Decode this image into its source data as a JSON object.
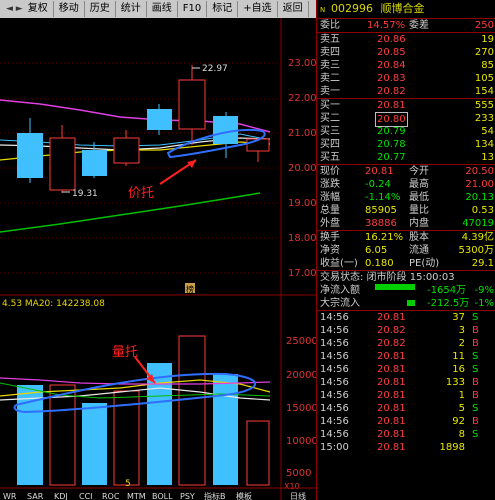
{
  "toolbar": {
    "buttons": [
      "复权",
      "移动",
      "历史",
      "统计",
      "画线",
      "F10",
      "标记",
      "+自选",
      "返回"
    ],
    "close": "×"
  },
  "chart": {
    "price_ticks": [
      "23.00",
      "22.00",
      "21.00",
      "20.00",
      "19.00",
      "18.00",
      "17.00"
    ],
    "high_label": "22.97",
    "low_label": "19.31",
    "annotation_price": "价托",
    "annotation_volume": "量托",
    "marker": "榜",
    "vol_header": "4.53  MA20: 142238.08",
    "vol_ticks": [
      "25000",
      "20000",
      "15000",
      "10000",
      "5000"
    ],
    "vol_unit": "X10",
    "bottom_tabs": [
      "WR",
      "SAR",
      "KDJ",
      "CCI",
      "ROC",
      "MTM",
      "BOLL",
      "PSY",
      "指标B",
      "模板"
    ],
    "bottom_right": "日线",
    "bottom_digit": "5"
  },
  "quote": {
    "code": "002996",
    "name": "顺博合金",
    "wei_bi_label": "委比",
    "wei_bi": "14.57%",
    "wei_cha_label": "委差",
    "wei_cha": "250",
    "asks": [
      {
        "label": "卖五",
        "price": "20.86",
        "vol": "19"
      },
      {
        "label": "卖四",
        "price": "20.85",
        "vol": "270"
      },
      {
        "label": "卖三",
        "price": "20.84",
        "vol": "85"
      },
      {
        "label": "卖二",
        "price": "20.83",
        "vol": "105"
      },
      {
        "label": "卖一",
        "price": "20.82",
        "vol": "154"
      }
    ],
    "bids": [
      {
        "label": "买一",
        "price": "20.81",
        "vol": "555"
      },
      {
        "label": "买二",
        "price": "20.80",
        "vol": "233"
      },
      {
        "label": "买三",
        "price": "20.79",
        "vol": "54"
      },
      {
        "label": "买四",
        "price": "20.78",
        "vol": "134"
      },
      {
        "label": "买五",
        "price": "20.77",
        "vol": "13"
      }
    ],
    "stats": [
      {
        "l1": "现价",
        "v1": "20.81",
        "l2": "今开",
        "v2": "20.50",
        "c1": "red",
        "c2": "red"
      },
      {
        "l1": "涨跌",
        "v1": "-0.24",
        "l2": "最高",
        "v2": "21.00",
        "c1": "green",
        "c2": "red"
      },
      {
        "l1": "涨幅",
        "v1": "-1.14%",
        "l2": "最低",
        "v2": "20.13",
        "c1": "green",
        "c2": "green"
      },
      {
        "l1": "总量",
        "v1": "85905",
        "l2": "量比",
        "v2": "0.53",
        "c1": "yellow",
        "c2": "yellow"
      },
      {
        "l1": "外盘",
        "v1": "38886",
        "l2": "内盘",
        "v2": "47019",
        "c1": "red",
        "c2": "green"
      }
    ],
    "stats2": [
      {
        "l1": "换手",
        "v1": "16.21%",
        "l2": "股本",
        "v2": "4.39亿"
      },
      {
        "l1": "净资",
        "v1": "6.05",
        "l2": "流通",
        "v2": "5300万"
      },
      {
        "l1": "收益(一)",
        "v1": "0.180",
        "l2": "PE(动)",
        "v2": "29.1"
      }
    ],
    "status_label": "交易状态: 闭市阶段 15:00:03",
    "net_inflow_label": "净流入额",
    "net_inflow_value": "-1654万",
    "net_inflow_pct": "-9%",
    "block_inflow_label": "大宗流入",
    "block_inflow_value": "-212.5万",
    "block_inflow_pct": "-1%"
  },
  "ticks": [
    {
      "time": "14:56",
      "price": "20.81",
      "vol": "37",
      "dir": "S"
    },
    {
      "time": "14:56",
      "price": "20.82",
      "vol": "3",
      "dir": "B"
    },
    {
      "time": "14:56",
      "price": "20.82",
      "vol": "2",
      "dir": "B"
    },
    {
      "time": "14:56",
      "price": "20.81",
      "vol": "11",
      "dir": "S"
    },
    {
      "time": "14:56",
      "price": "20.81",
      "vol": "16",
      "dir": "S"
    },
    {
      "time": "14:56",
      "price": "20.81",
      "vol": "133",
      "dir": "B"
    },
    {
      "time": "14:56",
      "price": "20.81",
      "vol": "1",
      "dir": "B"
    },
    {
      "time": "14:56",
      "price": "20.81",
      "vol": "5",
      "dir": "S"
    },
    {
      "time": "14:56",
      "price": "20.81",
      "vol": "92",
      "dir": "B"
    },
    {
      "time": "14:56",
      "price": "20.81",
      "vol": "8",
      "dir": "S"
    },
    {
      "time": "15:00",
      "price": "20.81",
      "vol": "1898",
      "dir": ""
    }
  ]
}
